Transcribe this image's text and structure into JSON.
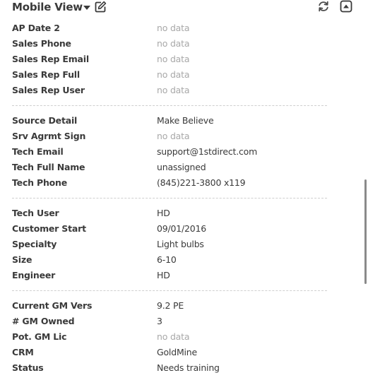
{
  "header": {
    "title": "Mobile View",
    "icons": {
      "dropdown": "caret-down-icon",
      "edit": "edit-icon",
      "refresh": "refresh-icon",
      "collapse": "collapse-up-icon"
    }
  },
  "groups": [
    {
      "rows": [
        {
          "label": "AP Date 2",
          "value": "no data",
          "empty": true
        },
        {
          "label": "Sales Phone",
          "value": "no data",
          "empty": true
        },
        {
          "label": "Sales Rep Email",
          "value": "no data",
          "empty": true
        },
        {
          "label": "Sales Rep Full",
          "value": "no data",
          "empty": true
        },
        {
          "label": "Sales Rep User",
          "value": "no data",
          "empty": true
        }
      ]
    },
    {
      "rows": [
        {
          "label": "Source Detail",
          "value": "Make Believe",
          "empty": false
        },
        {
          "label": "Srv Agrmt Sign",
          "value": "no data",
          "empty": true
        },
        {
          "label": "Tech Email",
          "value": "support@1stdirect.com",
          "empty": false
        },
        {
          "label": "Tech Full Name",
          "value": "unassigned",
          "empty": false
        },
        {
          "label": "Tech Phone",
          "value": "(845)221-3800 x119",
          "empty": false
        }
      ]
    },
    {
      "rows": [
        {
          "label": "Tech User",
          "value": "HD",
          "empty": false
        },
        {
          "label": "Customer Start",
          "value": "09/01/2016",
          "empty": false
        },
        {
          "label": "Specialty",
          "value": "Light bulbs",
          "empty": false
        },
        {
          "label": "Size",
          "value": "6-10",
          "empty": false
        },
        {
          "label": "Engineer",
          "value": "HD",
          "empty": false
        }
      ]
    },
    {
      "rows": [
        {
          "label": "Current GM Vers",
          "value": "9.2 PE",
          "empty": false
        },
        {
          "label": "# GM Owned",
          "value": "3",
          "empty": false
        },
        {
          "label": "Pot. GM Lic",
          "value": "no data",
          "empty": true
        },
        {
          "label": "CRM",
          "value": "GoldMine",
          "empty": false
        },
        {
          "label": "Status",
          "value": "Needs training",
          "empty": false
        }
      ]
    }
  ],
  "colors": {
    "label": "#3a3a3a",
    "value": "#3a3a3a",
    "empty_value": "#a8a8a8",
    "separator": "#cfcfcf",
    "scroll_thumb": "#8a8a8a"
  }
}
